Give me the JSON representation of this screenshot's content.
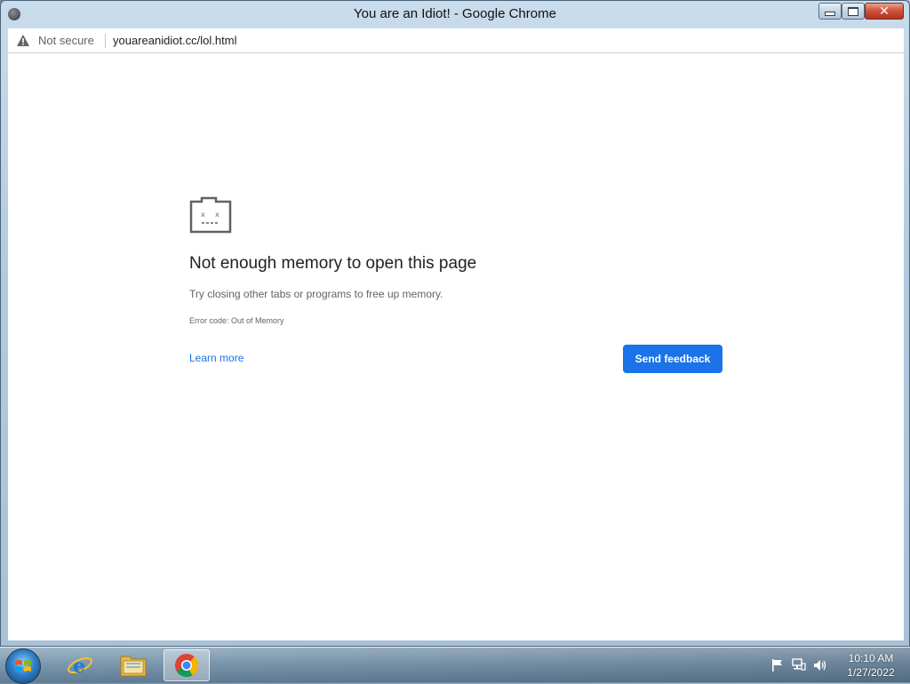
{
  "window": {
    "title": "You are an Idiot! - Google Chrome",
    "caption_buttons": [
      "minimize-icon",
      "maximize-icon",
      "close-icon"
    ]
  },
  "addressbar": {
    "security_label": "Not secure",
    "url": "youareanidiot.cc/lol.html"
  },
  "error_page": {
    "icon": "sad-tab-icon",
    "title": "Not enough memory to open this page",
    "message": "Try closing other tabs or programs to free up memory.",
    "error_code": "Error code: Out of Memory",
    "learn_more": "Learn more",
    "send_feedback": "Send feedback",
    "accent_color": "#1a73e8"
  },
  "taskbar": {
    "start_icon": "windows-start-icon",
    "pinned": [
      "internet-explorer-icon",
      "file-explorer-icon",
      "chrome-icon"
    ],
    "active": "chrome-icon",
    "tray": {
      "icons": [
        "action-center-flag-icon",
        "network-icon",
        "volume-icon"
      ],
      "time": "10:10 AM",
      "date": "1/27/2022"
    }
  }
}
